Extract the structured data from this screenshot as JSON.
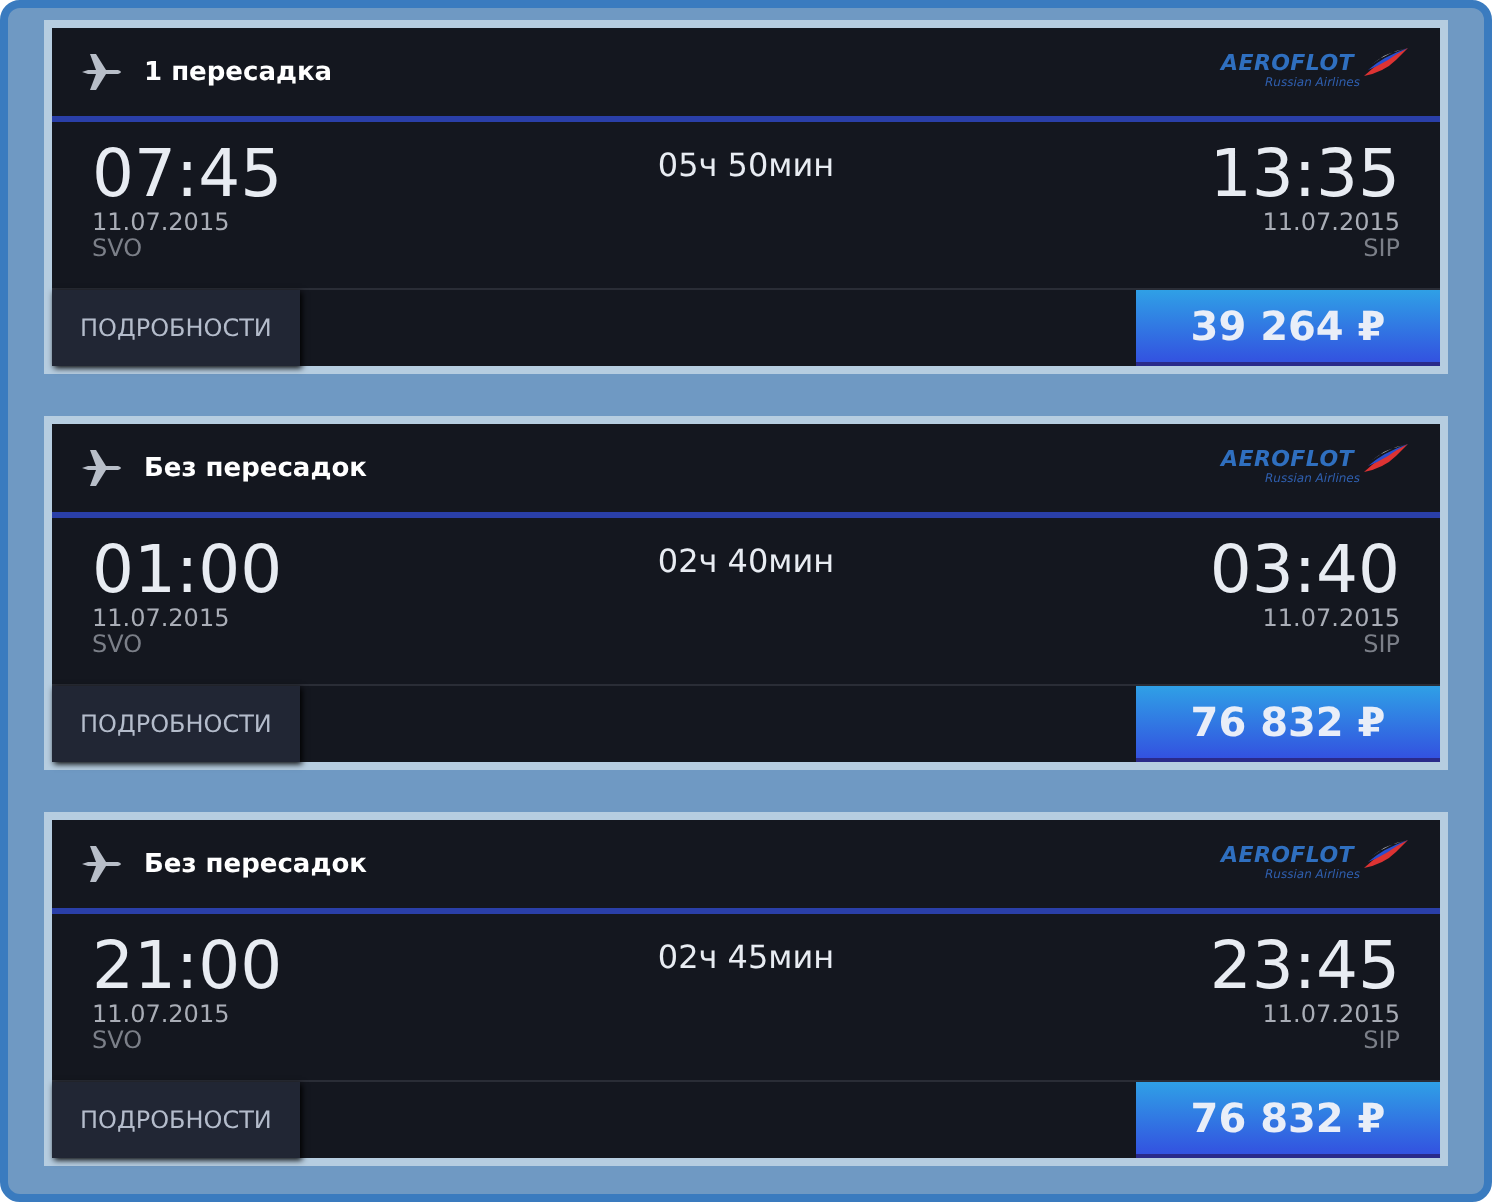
{
  "flights": [
    {
      "stops": "1 пересадка",
      "airline": {
        "name": "AEROFLOT",
        "tagline": "Russian Airlines"
      },
      "departure": {
        "time": "07:45",
        "date": "11.07.2015",
        "airport": "SVO"
      },
      "duration": "05ч 50мин",
      "arrival": {
        "time": "13:35",
        "date": "11.07.2015",
        "airport": "SIP"
      },
      "details_button": "ПОДРОБНОСТИ",
      "price": "39 264 ₽"
    },
    {
      "stops": "Без пересадок",
      "airline": {
        "name": "AEROFLOT",
        "tagline": "Russian Airlines"
      },
      "departure": {
        "time": "01:00",
        "date": "11.07.2015",
        "airport": "SVO"
      },
      "duration": "02ч 40мин",
      "arrival": {
        "time": "03:40",
        "date": "11.07.2015",
        "airport": "SIP"
      },
      "details_button": "ПОДРОБНОСТИ",
      "price": "76 832 ₽"
    },
    {
      "stops": "Без пересадок",
      "airline": {
        "name": "AEROFLOT",
        "tagline": "Russian Airlines"
      },
      "departure": {
        "time": "21:00",
        "date": "11.07.2015",
        "airport": "SVO"
      },
      "duration": "02ч 45мин",
      "arrival": {
        "time": "23:45",
        "date": "11.07.2015",
        "airport": "SIP"
      },
      "details_button": "ПОДРОБНОСТИ",
      "price": "76 832 ₽"
    }
  ]
}
